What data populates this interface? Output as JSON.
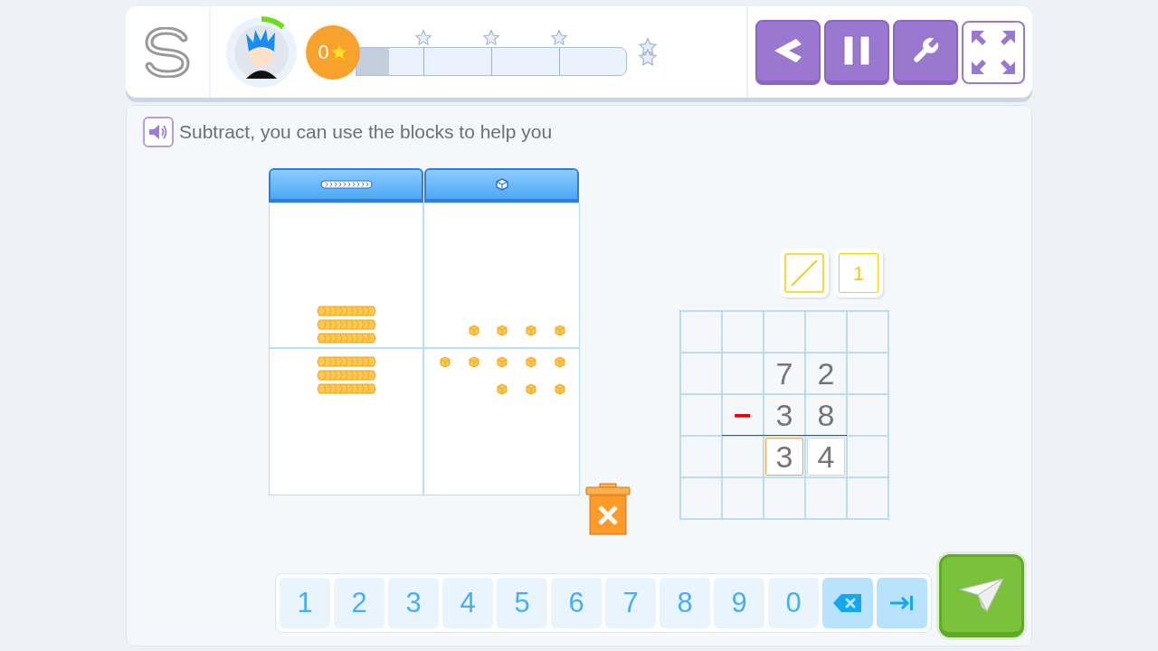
{
  "header": {
    "score": "0",
    "progress": {
      "level": 0.12
    },
    "milestones": [
      {
        "kind": "star"
      },
      {
        "kind": "star"
      },
      {
        "kind": "star"
      }
    ]
  },
  "instruction": "Subtract, you can use the blocks to help you",
  "place_value_mat": {
    "columns": [
      {
        "kind": "rod"
      },
      {
        "kind": "cube"
      }
    ],
    "rows": [
      {
        "cells": [
          {
            "items": [
              {
                "kind": "rod"
              },
              {
                "kind": "rod"
              },
              {
                "kind": "rod"
              }
            ]
          },
          {
            "items": [
              {
                "kind": "cube"
              },
              {
                "kind": "cube"
              },
              {
                "kind": "cube"
              },
              {
                "kind": "cube"
              }
            ]
          }
        ]
      },
      {
        "cells": [
          {
            "items": [
              {
                "kind": "rod"
              },
              {
                "kind": "rod"
              },
              {
                "kind": "rod"
              }
            ]
          },
          {
            "items": [
              {
                "kind": "cube"
              },
              {
                "kind": "cube"
              },
              {
                "kind": "cube"
              },
              {
                "kind": "cube"
              },
              {
                "kind": "cube"
              },
              {
                "kind": "cube"
              },
              {
                "kind": "cube"
              },
              {
                "kind": "cube"
              }
            ]
          }
        ]
      }
    ]
  },
  "carry_tools": [
    {
      "kind": "slash"
    },
    {
      "kind": "digit",
      "text": "1"
    }
  ],
  "grid": {
    "rows": [
      {
        "cells": [
          {
            "kind": "blank"
          },
          {
            "kind": "blank"
          },
          {
            "kind": "blank"
          },
          {
            "kind": "blank"
          },
          {
            "kind": "blank"
          }
        ]
      },
      {
        "cells": [
          {
            "kind": "blank"
          },
          {
            "kind": "blank"
          },
          {
            "kind": "digit",
            "text": "7"
          },
          {
            "kind": "digit",
            "text": "2"
          },
          {
            "kind": "blank"
          }
        ]
      },
      {
        "cells": [
          {
            "kind": "blank"
          },
          {
            "kind": "operator",
            "text": "−"
          },
          {
            "kind": "digit",
            "text": "3"
          },
          {
            "kind": "digit",
            "text": "8"
          },
          {
            "kind": "blank"
          }
        ],
        "underline": true
      },
      {
        "cells": [
          {
            "kind": "blank"
          },
          {
            "kind": "blank"
          },
          {
            "kind": "answer",
            "text": "3",
            "selected": true
          },
          {
            "kind": "answer",
            "text": "4",
            "selected": false
          },
          {
            "kind": "blank"
          }
        ]
      },
      {
        "cells": [
          {
            "kind": "blank"
          },
          {
            "kind": "blank"
          },
          {
            "kind": "blank"
          },
          {
            "kind": "blank"
          },
          {
            "kind": "blank"
          }
        ]
      }
    ]
  },
  "keypad": [
    {
      "kind": "digit",
      "text": "1"
    },
    {
      "kind": "digit",
      "text": "2"
    },
    {
      "kind": "digit",
      "text": "3"
    },
    {
      "kind": "digit",
      "text": "4"
    },
    {
      "kind": "digit",
      "text": "5"
    },
    {
      "kind": "digit",
      "text": "6"
    },
    {
      "kind": "digit",
      "text": "7"
    },
    {
      "kind": "digit",
      "text": "8"
    },
    {
      "kind": "digit",
      "text": "9"
    },
    {
      "kind": "digit",
      "text": "0"
    },
    {
      "kind": "backspace"
    },
    {
      "kind": "next"
    }
  ]
}
